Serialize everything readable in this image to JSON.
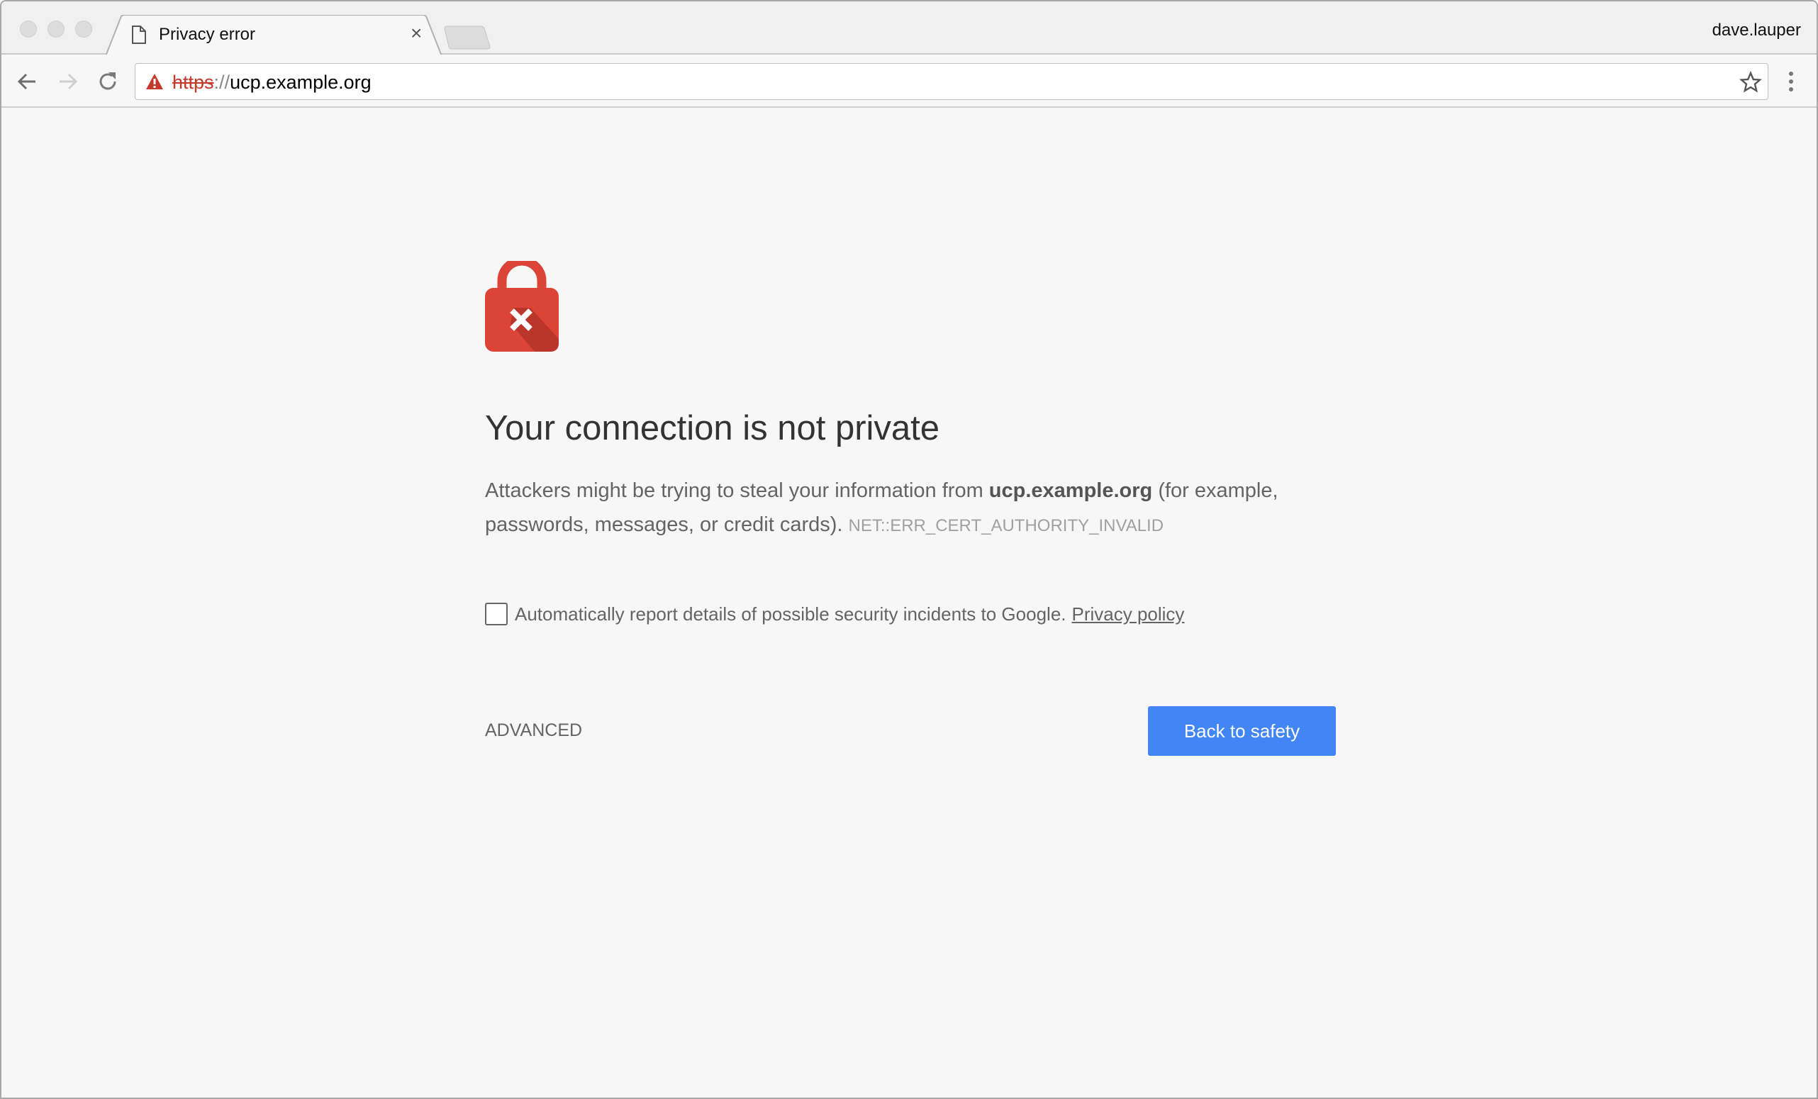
{
  "window": {
    "user": "dave.lauper"
  },
  "tabs": [
    {
      "title": "Privacy error",
      "icon": "document-icon"
    }
  ],
  "omnibox": {
    "scheme": "https",
    "separator": "://",
    "host": "ucp.example.org",
    "security": "not-secure-warning-icon"
  },
  "page": {
    "heading": "Your connection is not private",
    "body_prefix": "Attackers might be trying to steal your information from ",
    "body_host": "ucp.example.org",
    "body_suffix": " (for example, passwords, messages, or credit cards). ",
    "error_code": "NET::ERR_CERT_AUTHORITY_INVALID",
    "report_label": "Automatically report details of possible security incidents to Google.",
    "report_checked": false,
    "privacy_link": "Privacy policy",
    "advanced_label": "ADVANCED",
    "back_button": "Back to safety"
  },
  "colors": {
    "accent": "#4285f4",
    "danger": "#db4437",
    "scheme": "#c5392a"
  }
}
